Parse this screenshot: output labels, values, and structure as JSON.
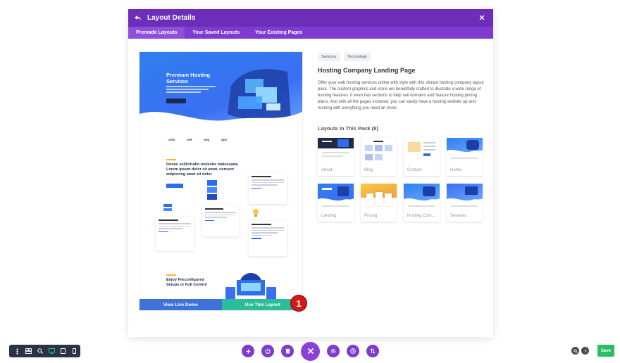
{
  "modal": {
    "title": "Layout Details",
    "tabs": [
      {
        "label": "Premade Layouts",
        "active": true
      },
      {
        "label": "Your Saved Layouts",
        "active": false
      },
      {
        "label": "Your Existing Pages",
        "active": false
      }
    ]
  },
  "preview": {
    "hero_title": "Premium Hosting Services",
    "logos": [
      ".com",
      ".net",
      ".org",
      ".gov"
    ],
    "section1_title": "Donec sollicitudin molestie malesuada. Lorem ipsum dolor sit amet, consect adipiscing amet sit dolor",
    "cards": [
      "Safe & Secure",
      "Uptime Guarantee",
      "Secure Backups",
      "Dedicated Support"
    ],
    "section2_title": "Enjoy Preconfigured Setups or Full Control",
    "view_demo_label": "View Live Demo",
    "use_layout_label": "Use This Layout",
    "step_badge": "1"
  },
  "info": {
    "tags": [
      "Services",
      "Technology"
    ],
    "title": "Hosting Company Landing Page",
    "description": "Offer your web hosting services online with style with this vibrant hosting company layout pack. The custom graphics and icons are beautifully crafted to illustrate a wide range of hosting features. It even has sections to help sell domains and feature hosting pricing plans. And with all the pages included, you can easily have a hosting website up and running with everything you need an more.",
    "pack_title": "Layouts In This Pack (8)",
    "layouts": [
      "About",
      "Blog",
      "Contact",
      "Home",
      "Landing",
      "Pricing",
      "Hosting Com...",
      "Services"
    ]
  },
  "toolbar": {
    "save_label": "Save"
  },
  "colors": {
    "header": "#6c2eb9",
    "tabs": "#7d3bcf",
    "demo_button": "#3f72d8",
    "use_button": "#2bbc9a",
    "save_button": "#2bbc64",
    "badge": "#d11a1a"
  }
}
